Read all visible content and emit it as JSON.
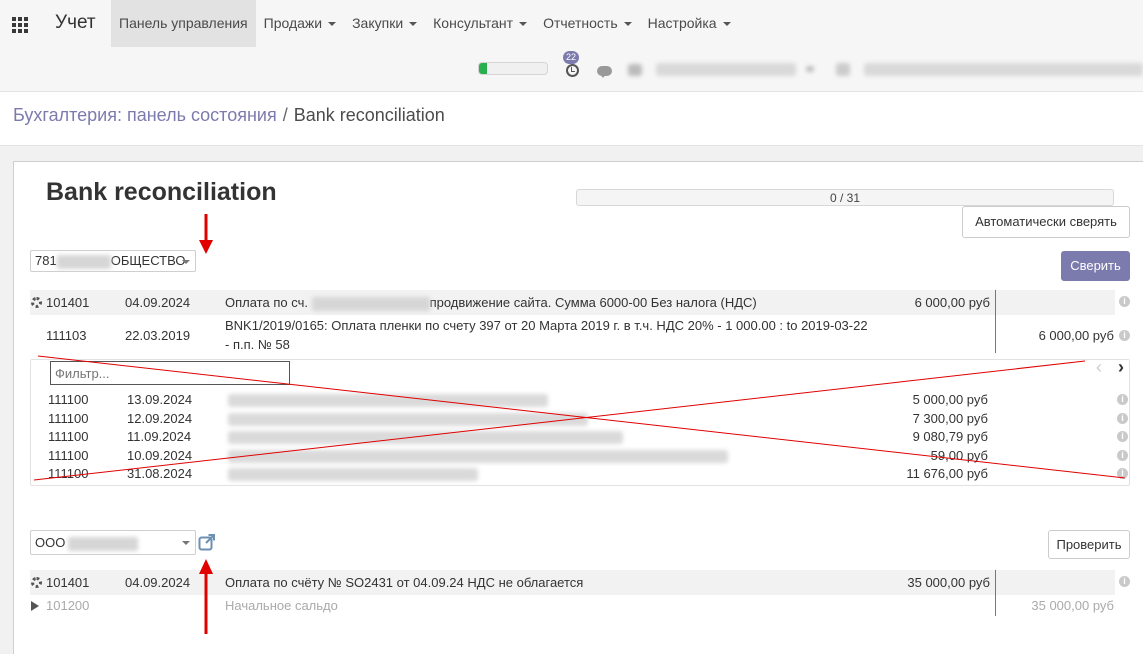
{
  "app": {
    "title": "Учет"
  },
  "menu": {
    "items": [
      {
        "label": "Панель управления",
        "active": true,
        "dropdown": false
      },
      {
        "label": "Продажи",
        "dropdown": true
      },
      {
        "label": "Закупки",
        "dropdown": true
      },
      {
        "label": "Консультант",
        "dropdown": true
      },
      {
        "label": "Отчетность",
        "dropdown": true
      },
      {
        "label": "Настройка",
        "dropdown": true
      }
    ]
  },
  "systray": {
    "activity_count": "22",
    "progress": 0.12
  },
  "breadcrumb": {
    "parent": "Бухгалтерия: панель состояния",
    "separator": "/",
    "current": "Bank reconciliation"
  },
  "page": {
    "title": "Bank reconciliation",
    "progress": "0 / 31",
    "auto_reconcile_label": "Автоматически сверять",
    "reconcile_label": "Сверить",
    "check_label": "Проверить"
  },
  "line1": {
    "partner_prefix": "781",
    "partner_suffix": "ОБЩЕСТВО",
    "statement": {
      "account": "101401",
      "date": "04.09.2024",
      "label_start": "Оплата по сч.",
      "label_end": "продвижение сайта. Сумма 6000-00 Без налога (НДС)",
      "amount": "6 000,00 руб"
    },
    "proposed": {
      "account": "111103",
      "date": "22.03.2019",
      "label_line1": "BNK1/2019/0165: Оплата пленки по счету 397 от 20 Марта 2019 г. в т.ч. НДС 20% - 1 000.00 : to 2019-03-22",
      "label_line2": "- п.п. № 58",
      "amount": "6 000,00 руб"
    },
    "filter_placeholder": "Фильтр...",
    "candidates": [
      {
        "account": "111100",
        "date": "13.09.2024",
        "amount": "5 000,00 руб"
      },
      {
        "account": "111100",
        "date": "12.09.2024",
        "amount": "7 300,00 руб"
      },
      {
        "account": "111100",
        "date": "11.09.2024",
        "amount": "9 080,79 руб"
      },
      {
        "account": "111100",
        "date": "10.09.2024",
        "amount": "59,00 руб"
      },
      {
        "account": "111100",
        "date": "31.08.2024",
        "amount": "11 676,00 руб"
      }
    ]
  },
  "line2": {
    "partner": "ООО",
    "statement": {
      "account": "101401",
      "date": "04.09.2024",
      "label": "Оплата по счёту № SO2431 от 04.09.24 НДС не облагается",
      "amount": "35 000,00 руб"
    },
    "opening": {
      "account": "101200",
      "label": "Начальное сальдо",
      "amount": "35 000,00 руб"
    }
  },
  "colors": {
    "accent": "#7c7bad",
    "annotation": "#e00000",
    "progress_green": "#28b04f"
  }
}
